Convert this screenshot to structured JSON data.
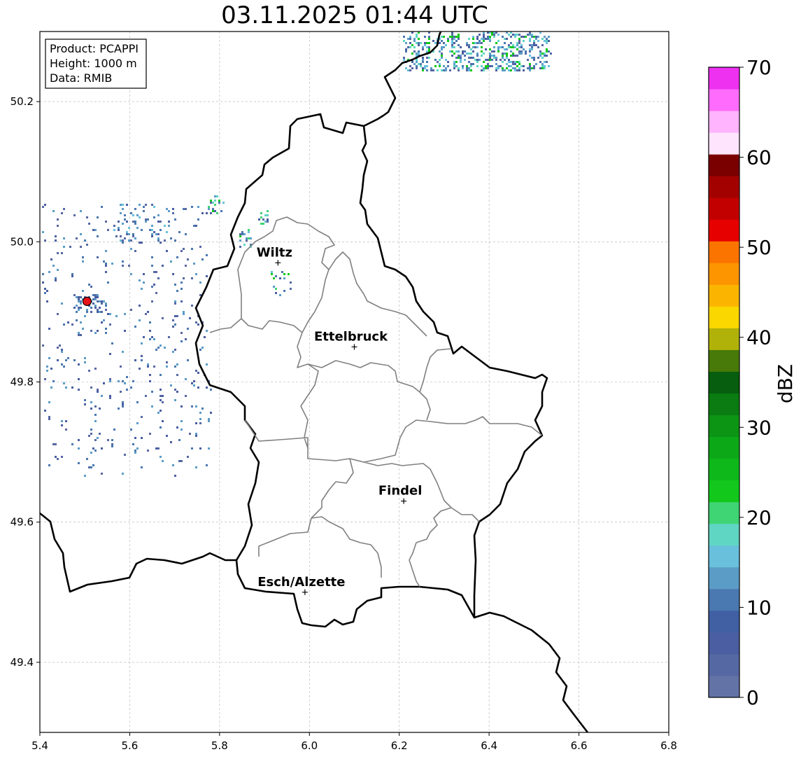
{
  "title": "03.11.2025 01:44 UTC",
  "info": {
    "product": "Product: PCAPPI",
    "height": "Height: 1000 m",
    "source": "Data: RMIB"
  },
  "axes": {
    "x_ticks": [
      "5.4",
      "5.6",
      "5.8",
      "6.0",
      "6.2",
      "6.4",
      "6.6",
      "6.8"
    ],
    "y_ticks": [
      "50.2",
      "50.0",
      "49.8",
      "49.6",
      "49.4"
    ],
    "xlim": [
      5.4,
      6.8
    ],
    "ylim": [
      49.3,
      50.3
    ],
    "grid": true
  },
  "cities": [
    {
      "name": "Wiltz",
      "lon": 5.93,
      "lat": 49.97
    },
    {
      "name": "Ettelbruck",
      "lon": 6.1,
      "lat": 49.85
    },
    {
      "name": "Findel",
      "lon": 6.21,
      "lat": 49.63
    },
    {
      "name": "Esch/Alzette",
      "lon": 5.99,
      "lat": 49.5
    }
  ],
  "radar_site": {
    "lon": 5.505,
    "lat": 49.915,
    "color": "#e8141a"
  },
  "colorbar": {
    "label": "dBZ",
    "ticks": [
      "0",
      "10",
      "20",
      "30",
      "40",
      "50",
      "60",
      "70"
    ],
    "min": 0,
    "max": 70,
    "colors": [
      "#6373a6",
      "#5668a3",
      "#4a5ea1",
      "#4060a3",
      "#4a78b0",
      "#5b9cc7",
      "#69c0dc",
      "#5fd6c4",
      "#3fd474",
      "#12c81a",
      "#0fb81a",
      "#0da817",
      "#0c9415",
      "#0a7c12",
      "#075e0e",
      "#477a08",
      "#b1b209",
      "#fbd700",
      "#fbb500",
      "#fc9500",
      "#fc7400",
      "#e60000",
      "#c20000",
      "#a30000",
      "#7a0000",
      "#ffe4fd",
      "#ffb4fd",
      "#ff6cfd",
      "#ee30f0"
    ]
  },
  "colors": {
    "border": "#000000",
    "cantons": "#808080",
    "grid": "#b0b0b0"
  }
}
